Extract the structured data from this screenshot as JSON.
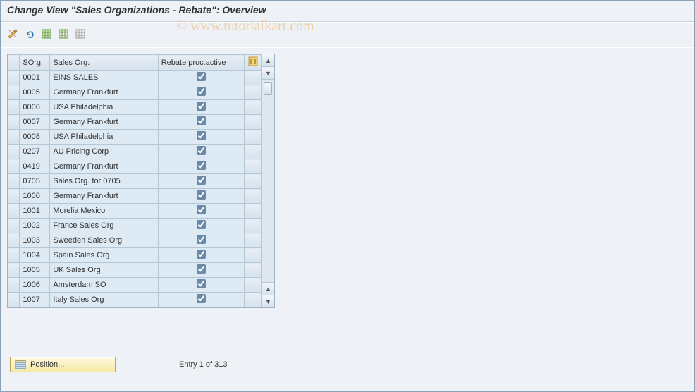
{
  "title": "Change View \"Sales Organizations - Rebate\": Overview",
  "watermark": "© www.tutorialkart.com",
  "toolbar": {
    "icons": [
      "pencil-crossed",
      "undo",
      "table-sel-all",
      "table-sel-block",
      "table-desel"
    ]
  },
  "table": {
    "headers": {
      "sorg": "SOrg.",
      "name": "Sales Org.",
      "rebate": "Rebate proc.active"
    },
    "rows": [
      {
        "sorg": "0001",
        "name": "EINS SALES",
        "rebate": true
      },
      {
        "sorg": "0005",
        "name": "Germany Frankfurt",
        "rebate": true
      },
      {
        "sorg": "0006",
        "name": "USA Philadelphia",
        "rebate": true
      },
      {
        "sorg": "0007",
        "name": "Germany Frankfurt",
        "rebate": true
      },
      {
        "sorg": "0008",
        "name": "USA Philadelphia",
        "rebate": true
      },
      {
        "sorg": "0207",
        "name": "AU Pricing Corp",
        "rebate": true
      },
      {
        "sorg": "0419",
        "name": "Germany Frankfurt",
        "rebate": true
      },
      {
        "sorg": "0705",
        "name": "Sales Org. for 0705",
        "rebate": true
      },
      {
        "sorg": "1000",
        "name": "Germany Frankfurt",
        "rebate": true
      },
      {
        "sorg": "1001",
        "name": "Morelia Mexico",
        "rebate": true
      },
      {
        "sorg": "1002",
        "name": "France Sales Org",
        "rebate": true
      },
      {
        "sorg": "1003",
        "name": "Sweeden Sales Org",
        "rebate": true
      },
      {
        "sorg": "1004",
        "name": "Spain Sales Org",
        "rebate": true
      },
      {
        "sorg": "1005",
        "name": "UK Sales Org",
        "rebate": true
      },
      {
        "sorg": "1006",
        "name": "Amsterdam SO",
        "rebate": true
      },
      {
        "sorg": "1007",
        "name": "Italy Sales Org",
        "rebate": true
      }
    ]
  },
  "footer": {
    "position_label": "Position...",
    "entry_text": "Entry 1 of 313"
  }
}
